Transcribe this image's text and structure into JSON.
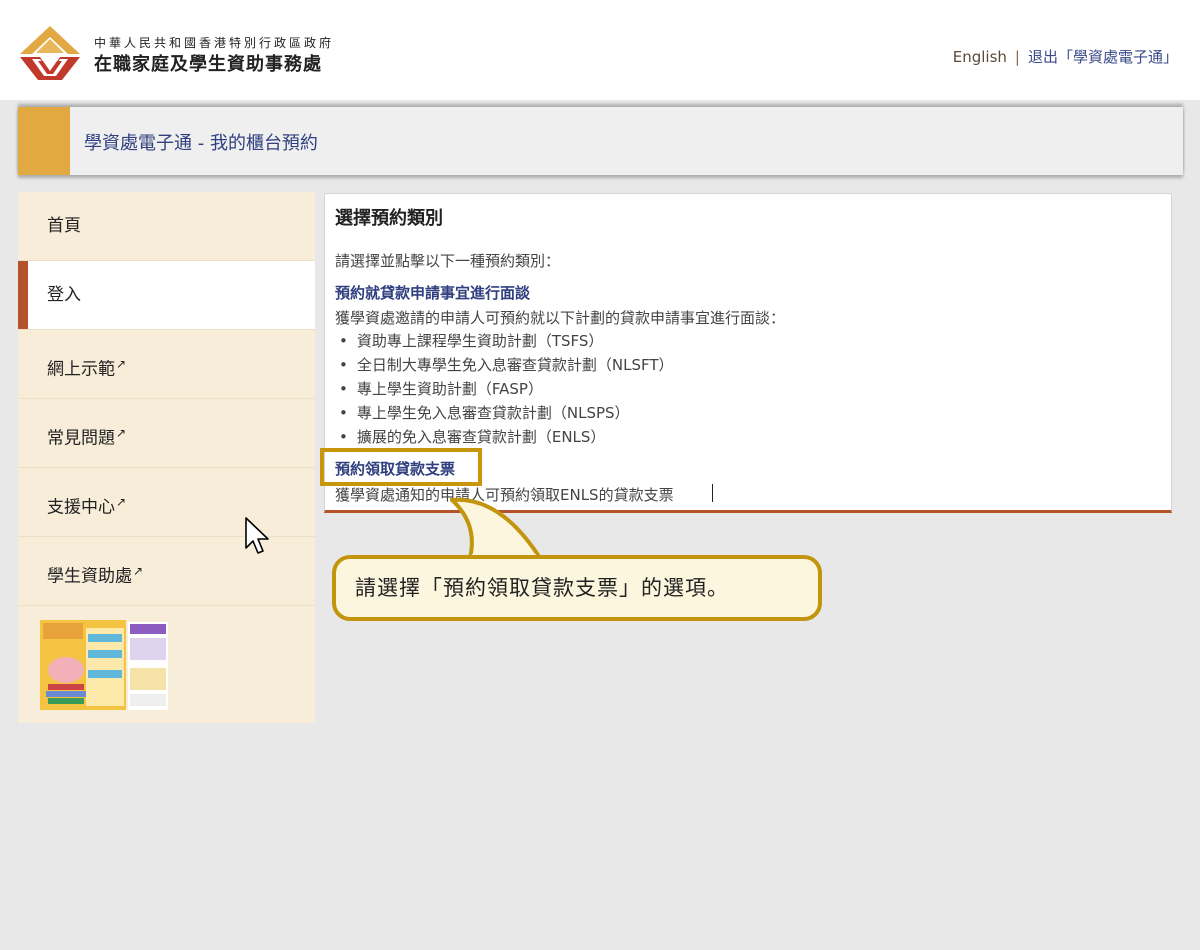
{
  "header": {
    "org_line1": "中華人民共和國香港特別行政區政府",
    "org_line2": "在職家庭及學生資助事務處",
    "english_link": "English",
    "separator": "|",
    "logout_link": "退出「學資處電子通」"
  },
  "titlebar": {
    "title": "學資處電子通 - 我的櫃台預約"
  },
  "sidebar": {
    "items": [
      {
        "label": "首頁",
        "external": false
      },
      {
        "label": "登入",
        "external": false,
        "active": true
      },
      {
        "label": "網上示範",
        "external": true
      },
      {
        "label": "常見問題",
        "external": true
      },
      {
        "label": "支援中心",
        "external": true
      },
      {
        "label": "學生資助處",
        "external": true
      }
    ],
    "banner_icon": "loan-info-leaflet-image"
  },
  "main": {
    "heading": "選擇預約類別",
    "instruction": "請選擇並點擊以下一種預約類別：",
    "section1": {
      "title": "預約就貸款申請事宜進行面談",
      "desc": "獲學資處邀請的申請人可預約就以下計劃的貸款申請事宜進行面談：",
      "schemes": [
        "資助專上課程學生資助計劃（TSFS）",
        "全日制大專學生免入息審查貸款計劃（NLSFT）",
        "專上學生資助計劃（FASP）",
        "專上學生免入息審查貸款計劃（NLSPS）",
        "擴展的免入息審查貸款計劃（ENLS）"
      ]
    },
    "section2": {
      "title": "預約領取貸款支票",
      "desc": "獲學資處通知的申請人可預約領取ENLS的貸款支票"
    }
  },
  "callout": {
    "text": "請選擇「預約領取貸款支票」的選項。"
  },
  "colors": {
    "accent_gold": "#e2a841",
    "active_bar": "#b5532c",
    "link_blue": "#2f3f7f",
    "highlight": "#c8960c",
    "sidebar_bg": "#f8edd9"
  }
}
